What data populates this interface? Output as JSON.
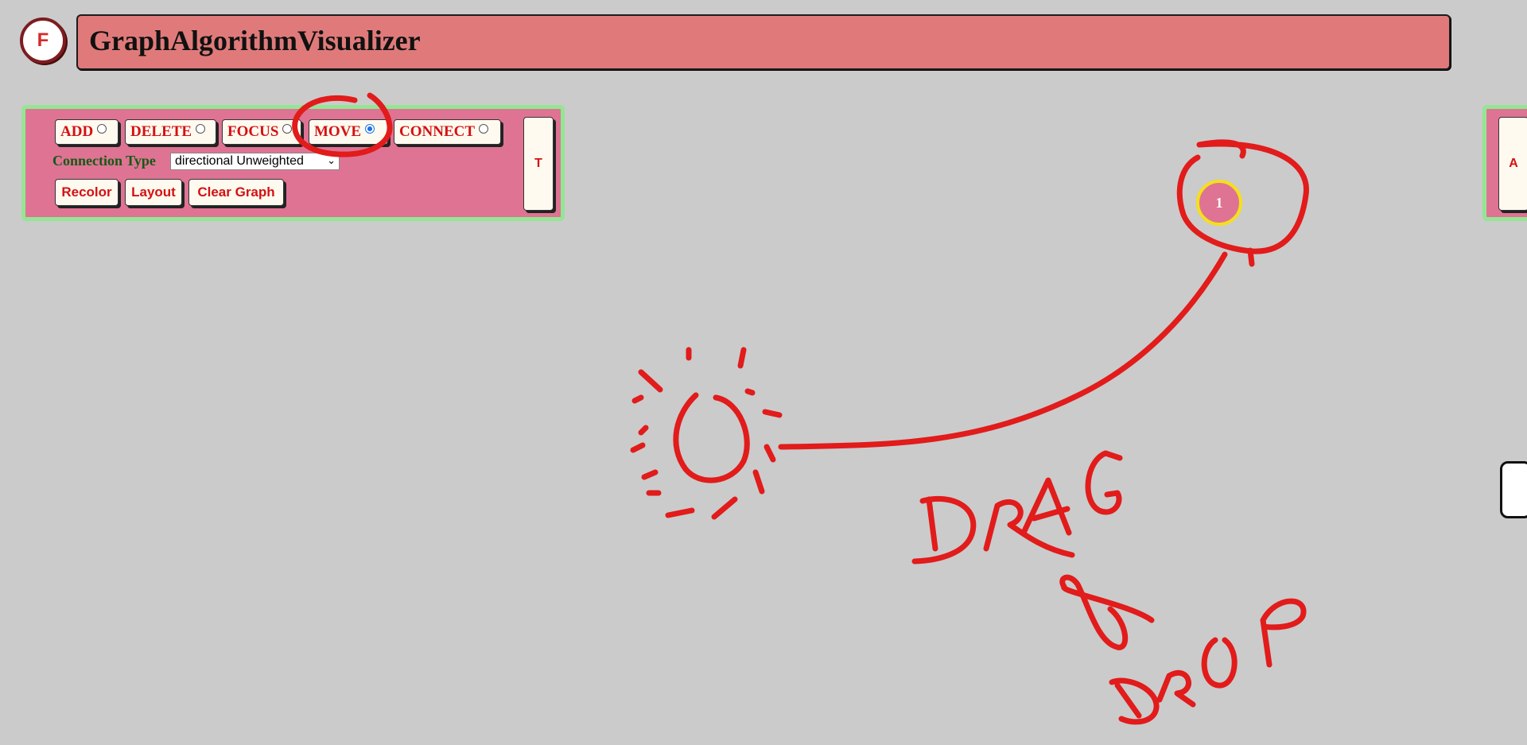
{
  "app": {
    "logo_letter": "F",
    "title": "GraphAlgorithmVisualizer"
  },
  "toolbar": {
    "modes": [
      {
        "label": "ADD",
        "selected": false
      },
      {
        "label": "DELETE",
        "selected": false
      },
      {
        "label": "FOCUS",
        "selected": false
      },
      {
        "label": "MOVE",
        "selected": true
      },
      {
        "label": "CONNECT",
        "selected": false
      }
    ],
    "connection_type_label": "Connection Type",
    "connection_type_value": "directional Unweighted",
    "actions": {
      "recolor": "Recolor",
      "layout": "Layout",
      "clear": "Clear Graph"
    },
    "toggle_label": "T"
  },
  "right_panel": {
    "toggle_label": "A"
  },
  "graph": {
    "nodes": [
      {
        "label": "1"
      }
    ]
  },
  "annotation": {
    "text_line1": "DRAG",
    "text_line2": "&",
    "text_line3": "DROP",
    "ink_color": "#e21b1b"
  },
  "colors": {
    "background": "#cbcbcb",
    "title_bar": "#e07a7a",
    "panel": "#df7394",
    "panel_border": "#93e693",
    "node_ring": "#f4e01a"
  }
}
